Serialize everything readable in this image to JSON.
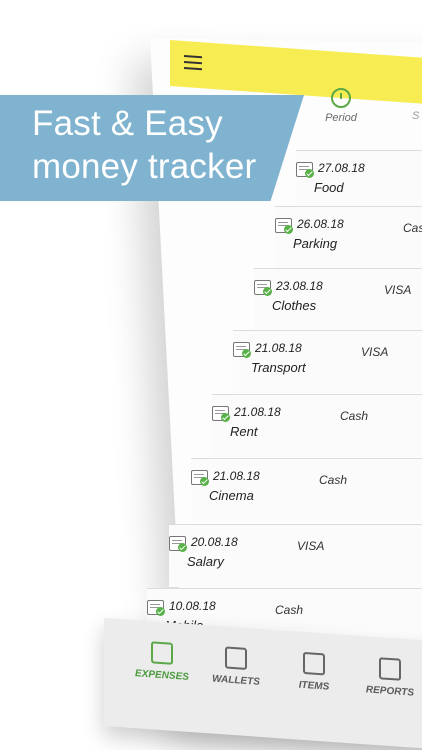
{
  "banner": {
    "line1": "Fast & Easy",
    "line2": "money tracker"
  },
  "tabs": {
    "period": "Period",
    "next": "S"
  },
  "rows": [
    {
      "date": "27.08.18",
      "name": "Food",
      "pay": ""
    },
    {
      "date": "26.08.18",
      "name": "Parking",
      "pay": "Cas"
    },
    {
      "date": "23.08.18",
      "name": "Clothes",
      "pay": "VISA"
    },
    {
      "date": "21.08.18",
      "name": "Transport",
      "pay": "VISA"
    },
    {
      "date": "21.08.18",
      "name": "Rent",
      "pay": "Cash"
    },
    {
      "date": "21.08.18",
      "name": "Cinema",
      "pay": "Cash"
    },
    {
      "date": "20.08.18",
      "name": "Salary",
      "pay": "VISA"
    },
    {
      "date": "10.08.18",
      "name": "Mobile",
      "pay": "Cash"
    }
  ],
  "nav": {
    "expenses": "EXPENSES",
    "wallets": "WALLETS",
    "items": "ITEMS",
    "reports": "REPORTS"
  },
  "colors": {
    "accent_yellow": "#f7ec52",
    "accent_green": "#5aa847",
    "banner_blue": "#7fb3cf"
  }
}
